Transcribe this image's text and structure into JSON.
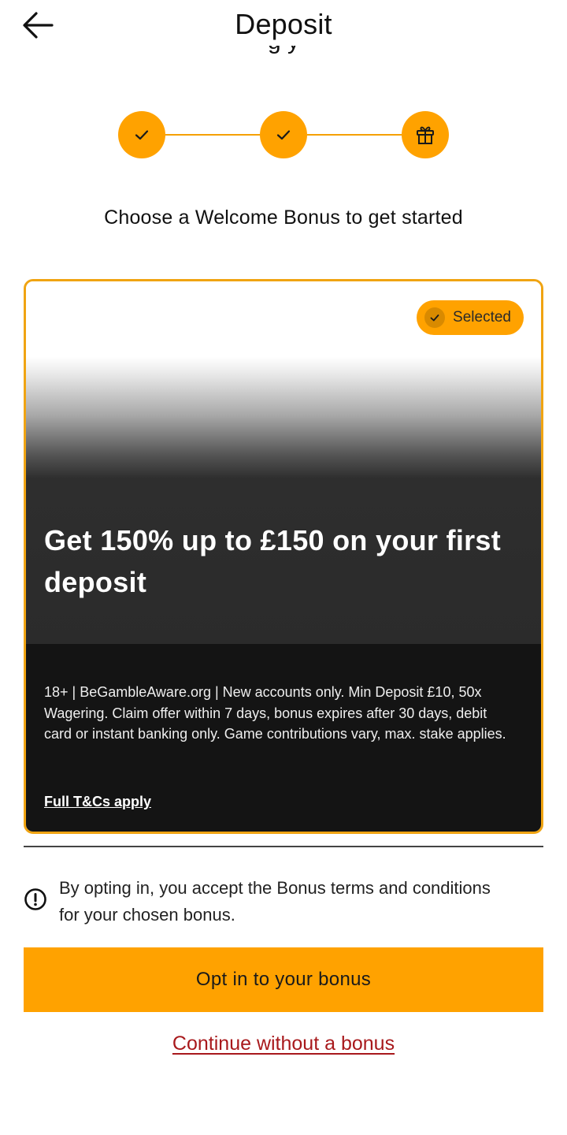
{
  "header": {
    "title": "Deposit",
    "back_icon": "arrow-left-icon",
    "partially_hidden_subtitle": "g y"
  },
  "stepper": {
    "steps": [
      {
        "icon": "check-icon",
        "state": "complete"
      },
      {
        "icon": "check-icon",
        "state": "complete"
      },
      {
        "icon": "gift-icon",
        "state": "current"
      }
    ],
    "color": "#ffa200"
  },
  "main": {
    "choose_title": "Choose a Welcome Bonus to get started"
  },
  "bonus_card": {
    "selected_label": "Selected",
    "headline": "Get 150% up to £150 on your first deposit",
    "terms": "18+ | BeGambleAware.org | New accounts only. Min Deposit £10, 50x Wagering. Claim offer within 7 days, bonus expires after 30 days, debit card or instant banking only. Game contributions vary, max. stake applies.",
    "tcs_link": "Full T&Cs apply",
    "border_color": "#f0a412"
  },
  "notice": {
    "icon": "exclamation-circle-icon",
    "text": "By opting in, you accept the Bonus terms and conditions for your chosen bonus."
  },
  "actions": {
    "opt_in_label": "Opt in to your bonus",
    "continue_label": "Continue without a bonus",
    "primary_color": "#ffa200",
    "link_color": "#a8191c"
  }
}
